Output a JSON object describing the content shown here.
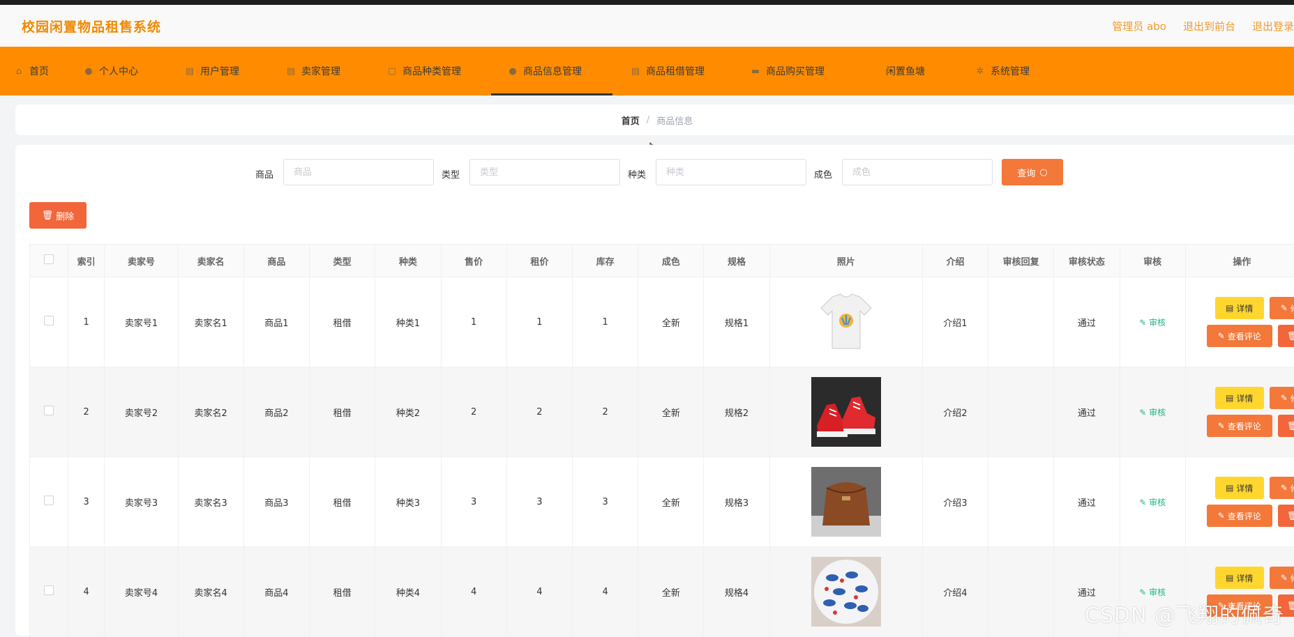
{
  "header": {
    "title": "校园闲置物品租售系统",
    "admin_label": "管理员 abo",
    "exit_front_label": "退出到前台",
    "logout_label": "退出登录"
  },
  "nav": {
    "items": [
      {
        "label": "首页",
        "icon": "home-icon"
      },
      {
        "label": "个人中心",
        "icon": "user-icon"
      },
      {
        "label": "用户管理",
        "icon": "doc-icon"
      },
      {
        "label": "卖家管理",
        "icon": "doc-icon"
      },
      {
        "label": "商品种类管理",
        "icon": "calendar-icon"
      },
      {
        "label": "商品信息管理",
        "icon": "user-icon"
      },
      {
        "label": "商品租借管理",
        "icon": "doc-icon"
      },
      {
        "label": "商品购买管理",
        "icon": "chat-icon"
      },
      {
        "label": "闲置鱼塘",
        "icon": "blank-icon"
      },
      {
        "label": "系统管理",
        "icon": "gear-icon"
      }
    ],
    "active_index": 5
  },
  "breadcrumb": {
    "home": "首页",
    "separator": "/",
    "current": "商品信息"
  },
  "search": {
    "fields": [
      {
        "label": "商品",
        "placeholder": "商品"
      },
      {
        "label": "类型",
        "placeholder": "类型"
      },
      {
        "label": "种类",
        "placeholder": "种类"
      },
      {
        "label": "成色",
        "placeholder": "成色"
      }
    ],
    "query_label": "查询"
  },
  "toolbar": {
    "bulk_delete_label": "删除"
  },
  "table": {
    "columns": [
      "索引",
      "卖家号",
      "卖家名",
      "商品",
      "类型",
      "种类",
      "售价",
      "租价",
      "库存",
      "成色",
      "规格",
      "照片",
      "介绍",
      "审核回复",
      "审核状态",
      "审核",
      "操作"
    ],
    "rows": [
      {
        "index": "1",
        "seller_no": "卖家号1",
        "seller_name": "卖家名1",
        "product": "商品1",
        "type": "租借",
        "category": "种类1",
        "sale_price": "1",
        "rent_price": "1",
        "stock": "1",
        "condition": "全新",
        "spec": "规格1",
        "photo": "t-shirt",
        "intro": "介绍1",
        "reply": "",
        "status": "通过",
        "audit": "审核"
      },
      {
        "index": "2",
        "seller_no": "卖家号2",
        "seller_name": "卖家名2",
        "product": "商品2",
        "type": "租借",
        "category": "种类2",
        "sale_price": "2",
        "rent_price": "2",
        "stock": "2",
        "condition": "全新",
        "spec": "规格2",
        "photo": "red-sneakers",
        "intro": "介绍2",
        "reply": "",
        "status": "通过",
        "audit": "审核"
      },
      {
        "index": "3",
        "seller_no": "卖家号3",
        "seller_name": "卖家名3",
        "product": "商品3",
        "type": "租借",
        "category": "种类3",
        "sale_price": "3",
        "rent_price": "3",
        "stock": "3",
        "condition": "全新",
        "spec": "规格3",
        "photo": "brown-bag",
        "intro": "介绍3",
        "reply": "",
        "status": "通过",
        "audit": "审核"
      },
      {
        "index": "4",
        "seller_no": "卖家号4",
        "seller_name": "卖家名4",
        "product": "商品4",
        "type": "租借",
        "category": "种类4",
        "sale_price": "4",
        "rent_price": "4",
        "stock": "4",
        "condition": "全新",
        "spec": "规格4",
        "photo": "candies",
        "intro": "介绍4",
        "reply": "",
        "status": "通过",
        "audit": "审核"
      }
    ],
    "actions": {
      "detail": "详情",
      "edit": "修改",
      "comments": "查看评论",
      "delete": "删除"
    }
  },
  "watermark": "CSDN @飞翔的佩奇",
  "colors": {
    "accent": "#ff8c00",
    "title": "#f08a00",
    "button_orange": "#f3783a",
    "button_yellow": "#ffd62e",
    "audit_green": "#21b58a"
  }
}
